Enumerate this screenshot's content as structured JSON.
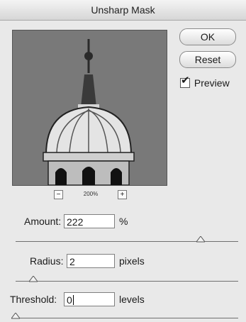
{
  "window": {
    "title": "Unsharp Mask"
  },
  "zoom": {
    "minus_label": "−",
    "plus_label": "+",
    "level": "200%"
  },
  "buttons": {
    "ok": "OK",
    "reset": "Reset"
  },
  "preview_option": {
    "label": "Preview",
    "checked": true
  },
  "amount": {
    "label": "Amount:",
    "value": "222",
    "unit": "%",
    "slider_fraction": 0.83
  },
  "radius": {
    "label": "Radius:",
    "value": "2",
    "unit": "pixels",
    "slider_fraction": 0.08
  },
  "threshold": {
    "label": "Threshold:",
    "value": "0",
    "unit": "levels",
    "slider_fraction": 0.0
  }
}
